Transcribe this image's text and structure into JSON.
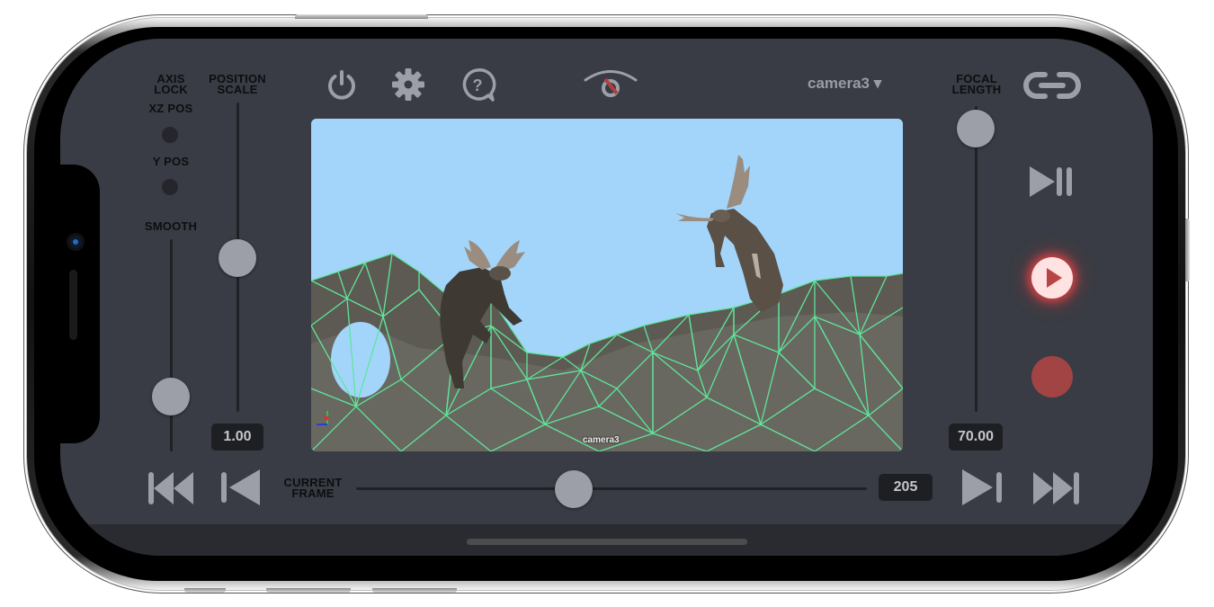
{
  "left_panel": {
    "axis_lock_label": "AXIS\nLOCK",
    "xz_pos_label": "XZ POS",
    "y_pos_label": "Y POS",
    "smooth_label": "SMOOTH",
    "position_scale_label": "POSITION\nSCALE",
    "position_scale_value": "1.00"
  },
  "top_bar": {
    "icons": [
      "power-icon",
      "gear-icon",
      "help-chat-icon",
      "eye-hidden-icon"
    ],
    "camera_select": "camera3 ▾",
    "focal_length_label": "FOCAL\nLENGTH",
    "link_icon": "link-icon"
  },
  "viewport": {
    "camera_label": "camera3",
    "sky_color": "#a3d5fb",
    "wireframe_color": "#5fe59a"
  },
  "right_panel": {
    "focal_length_value": "70.00",
    "step_play_icon": "play-pause-step-icon",
    "play_icon": "play-icon",
    "record_icon": "record-icon"
  },
  "timeline": {
    "current_frame_label": "CURRENT\nFRAME",
    "current_frame_value": "205",
    "first_frame_icon": "skip-to-start-icon",
    "prev_frame_icon": "previous-frame-icon",
    "next_frame_icon": "next-frame-icon",
    "last_frame_icon": "skip-to-end-icon"
  },
  "colors": {
    "background": "#393c44",
    "control_gray": "#9c9ea8",
    "record_red": "#a34444",
    "play_glow": "#ff4646"
  }
}
